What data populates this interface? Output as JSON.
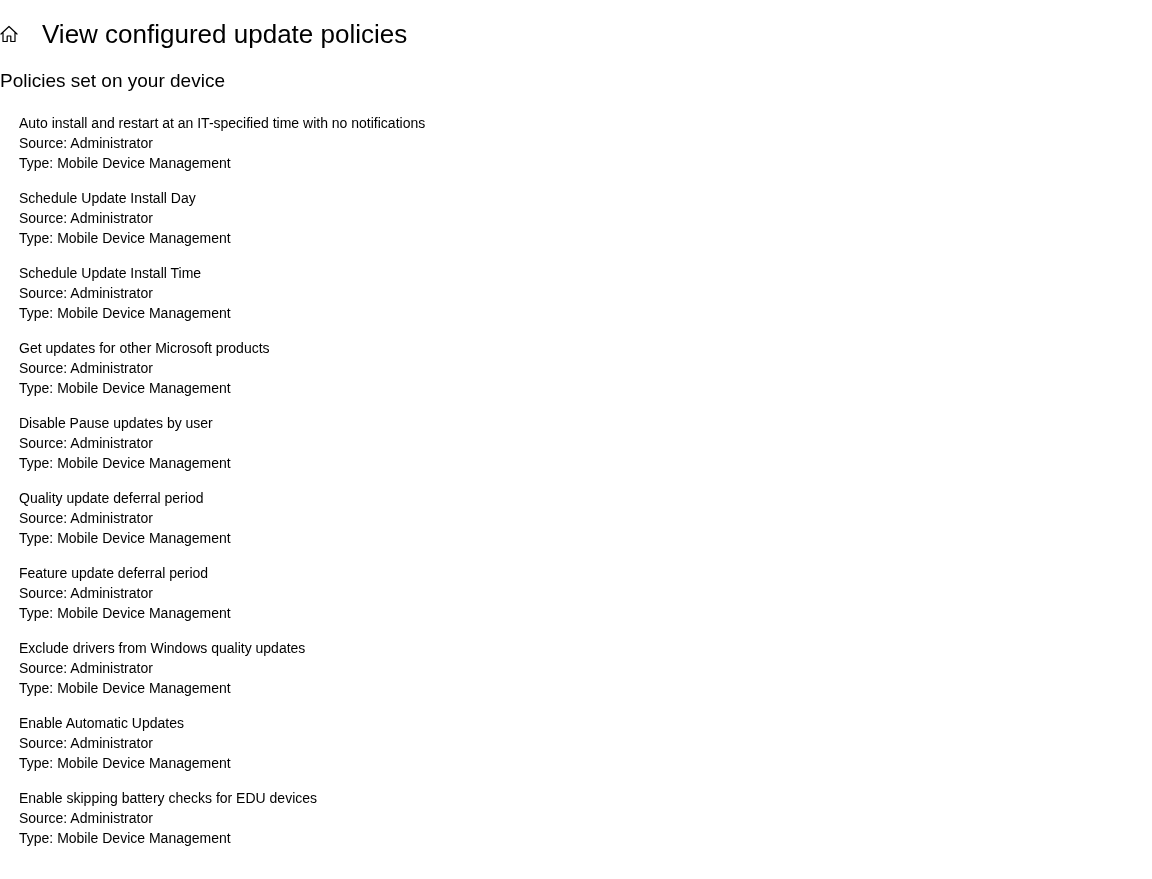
{
  "header": {
    "title": "View configured update policies"
  },
  "section": {
    "heading": "Policies set on your device"
  },
  "policies": [
    {
      "name": "Auto install and restart at an IT-specified time with no notifications",
      "source": "Source: Administrator",
      "type": "Type: Mobile Device Management"
    },
    {
      "name": "Schedule Update Install Day",
      "source": "Source: Administrator",
      "type": "Type: Mobile Device Management"
    },
    {
      "name": "Schedule Update Install Time",
      "source": "Source: Administrator",
      "type": "Type: Mobile Device Management"
    },
    {
      "name": "Get updates for other Microsoft products",
      "source": "Source: Administrator",
      "type": "Type: Mobile Device Management"
    },
    {
      "name": "Disable Pause updates by user",
      "source": "Source: Administrator",
      "type": "Type: Mobile Device Management"
    },
    {
      "name": "Quality update deferral period",
      "source": "Source: Administrator",
      "type": "Type: Mobile Device Management"
    },
    {
      "name": "Feature update deferral period",
      "source": "Source: Administrator",
      "type": "Type: Mobile Device Management"
    },
    {
      "name": "Exclude drivers from Windows quality updates",
      "source": "Source: Administrator",
      "type": "Type: Mobile Device Management"
    },
    {
      "name": "Enable Automatic Updates",
      "source": "Source: Administrator",
      "type": "Type: Mobile Device Management"
    },
    {
      "name": "Enable skipping battery checks for EDU devices",
      "source": "Source: Administrator",
      "type": "Type: Mobile Device Management"
    }
  ]
}
